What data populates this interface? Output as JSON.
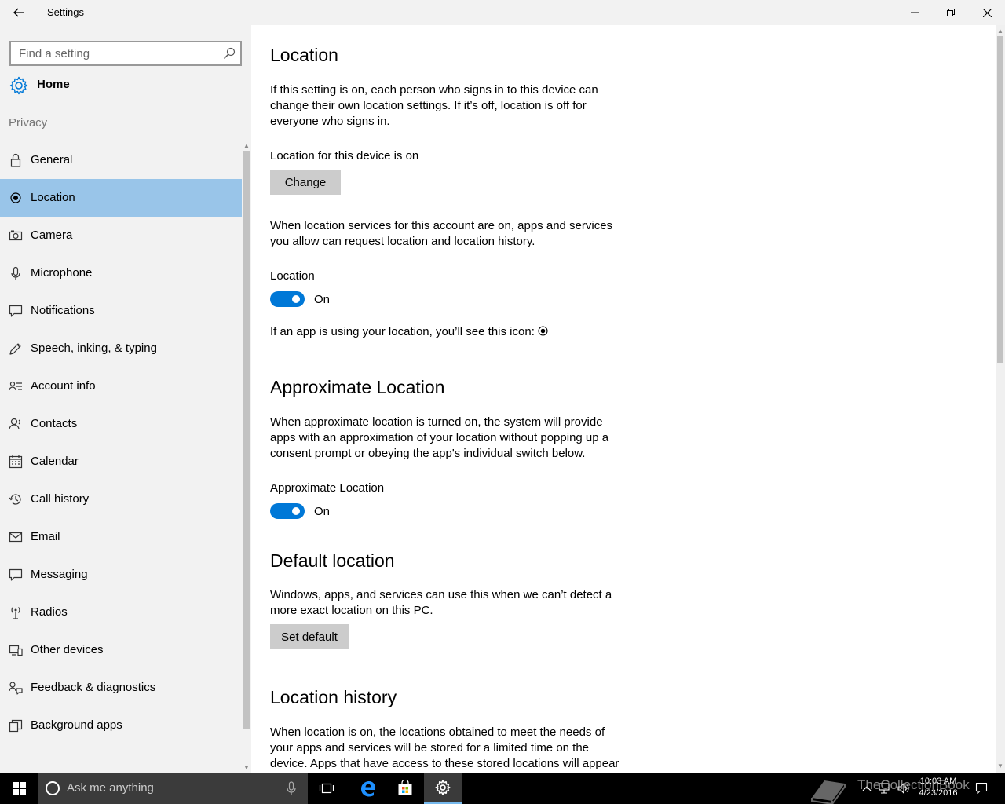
{
  "window": {
    "title": "Settings"
  },
  "sidebar": {
    "search_placeholder": "Find a setting",
    "home_label": "Home",
    "section": "Privacy",
    "items": [
      {
        "label": "General",
        "icon": "lock-icon"
      },
      {
        "label": "Location",
        "icon": "location-icon",
        "active": true
      },
      {
        "label": "Camera",
        "icon": "camera-icon"
      },
      {
        "label": "Microphone",
        "icon": "microphone-icon"
      },
      {
        "label": "Notifications",
        "icon": "notifications-icon"
      },
      {
        "label": "Speech, inking, & typing",
        "icon": "speech-icon"
      },
      {
        "label": "Account info",
        "icon": "account-info-icon"
      },
      {
        "label": "Contacts",
        "icon": "contacts-icon"
      },
      {
        "label": "Calendar",
        "icon": "calendar-icon"
      },
      {
        "label": "Call history",
        "icon": "call-history-icon"
      },
      {
        "label": "Email",
        "icon": "email-icon"
      },
      {
        "label": "Messaging",
        "icon": "messaging-icon"
      },
      {
        "label": "Radios",
        "icon": "radios-icon"
      },
      {
        "label": "Other devices",
        "icon": "other-devices-icon"
      },
      {
        "label": "Feedback & diagnostics",
        "icon": "feedback-icon"
      },
      {
        "label": "Background apps",
        "icon": "background-apps-icon"
      }
    ]
  },
  "main": {
    "location": {
      "title": "Location",
      "description": "If this setting is on, each person who signs in to this device can change their own location settings. If it’s off, location is off for everyone who signs in.",
      "device_status": "Location for this device is on",
      "change_button": "Change",
      "account_description": "When location services for this account are on, apps and services you allow can request location and location history.",
      "toggle_label": "Location",
      "toggle_state": "On",
      "icon_hint": "If an app is using your location, you’ll see this icon:"
    },
    "approximate": {
      "title": "Approximate Location",
      "description": "When approximate location is turned on, the system will provide apps with an approximation of your location without popping up a consent prompt or obeying the app's individual switch below.",
      "toggle_label": "Approximate Location",
      "toggle_state": "On"
    },
    "default_location": {
      "title": "Default location",
      "description": "Windows, apps, and services can use this when we can’t detect a more exact location on this PC.",
      "button": "Set default"
    },
    "history": {
      "title": "Location history",
      "description": "When location is on, the locations obtained to meet the needs of your apps and services will be stored for a limited time on the device. Apps that have access to these stored locations will appear"
    }
  },
  "taskbar": {
    "search_placeholder": "Ask me anything",
    "time": "10:03 AM",
    "date": "4/23/2016",
    "watermark": "TheCollectionBook"
  },
  "colors": {
    "accent": "#0078d7",
    "nav_selected": "#99c5e9",
    "sidebar_bg": "#f2f2f2",
    "taskbar_bg": "#000000"
  }
}
